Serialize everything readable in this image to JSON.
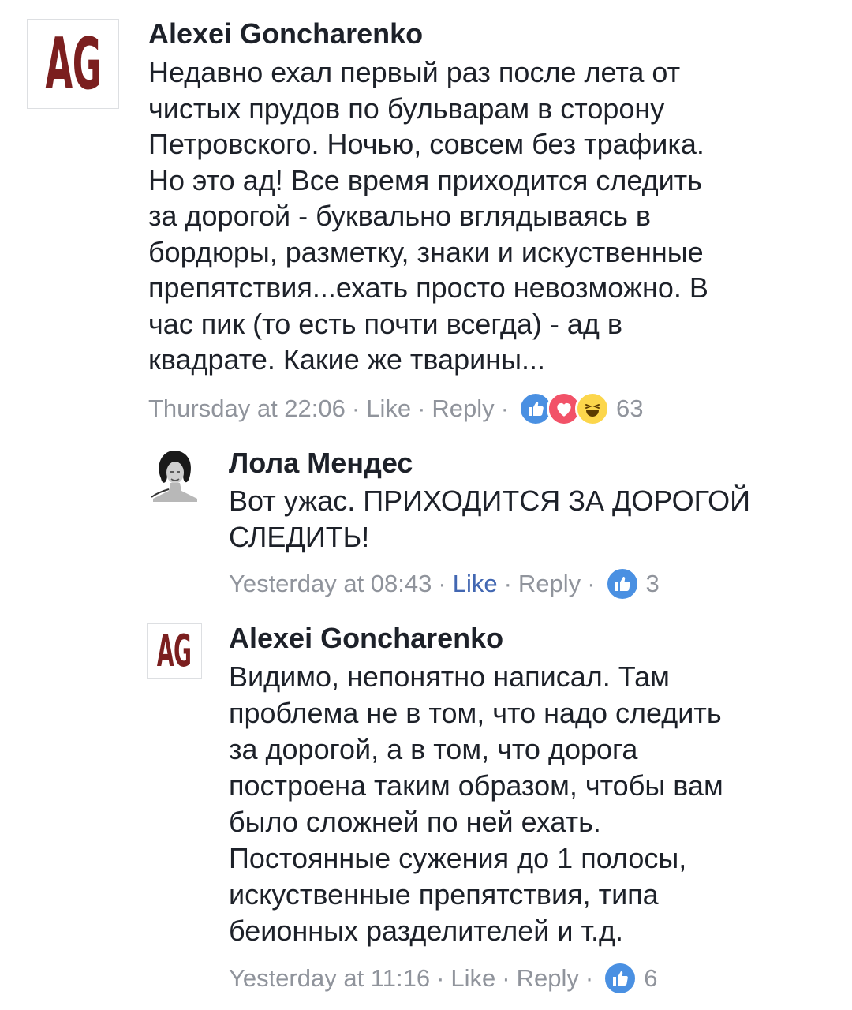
{
  "comments": [
    {
      "author": "Alexei Goncharenko",
      "avatar_text": "AG",
      "lines": [
        "Недавно ехал первый раз после лета от",
        "чистых прудов по бульварам в сторону",
        "Петровского. Ночью,  совсем без трафика.",
        "Но это ад! Все время приходится следить",
        "за дорогой - буквально вглядываясь в",
        "бордюры, разметку,  знаки и искуственные",
        "препятствия...ехать просто невозможно. В",
        "час пик (то есть почти всегда) - ад в",
        "квадрате. Какие же тварины..."
      ],
      "time": "Thursday at 22:06",
      "like_label": "Like",
      "reply_label": "Reply",
      "separator": "·",
      "reactions": [
        "like-icon",
        "love-icon",
        "haha-icon"
      ],
      "reaction_count": "63",
      "liked": false
    },
    {
      "author": "Лола Мендес",
      "avatar_text": "",
      "lines": [
        "Вот ужас. ПРИХОДИТСЯ ЗА ДОРОГОЙ",
        "СЛЕДИТЬ!"
      ],
      "time": "Yesterday at 08:43",
      "like_label": "Like",
      "reply_label": "Reply",
      "separator": "·",
      "reactions": [
        "like-icon"
      ],
      "reaction_count": "3",
      "liked": true
    },
    {
      "author": "Alexei Goncharenko",
      "avatar_text": "AG",
      "lines": [
        "Видимо, непонятно написал. Там",
        "проблема не в том, что надо следить",
        "за дорогой, а в том, что дорога",
        "построена таким образом, чтобы вам",
        "было сложней по ней ехать.",
        "Постоянные сужения до 1 полосы,",
        "искуственные препятствия, типа",
        "беионных разделителей и т.д."
      ],
      "time": "Yesterday at 11:16",
      "like_label": "Like",
      "reply_label": "Reply",
      "separator": "·",
      "reactions": [
        "like-icon"
      ],
      "reaction_count": "6",
      "liked": false
    }
  ],
  "colors": {
    "text": "#1d2129",
    "meta": "#90949c",
    "link_blue": "#4267b2",
    "like_blue": "#4a90e2",
    "love_red": "#f25268",
    "haha_yellow": "#fcd64b",
    "logo_red": "#7b1f1f"
  }
}
